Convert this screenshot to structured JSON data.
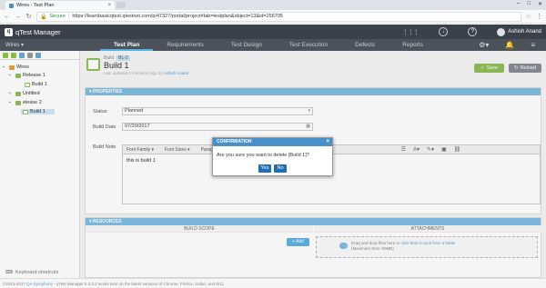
{
  "browser": {
    "tab_title": "Wires - Test Plan",
    "secure_label": "Secure",
    "url": "https://learnbasicqtest.qtestnet.com/p/47327/portal/project#tab=testplan&object=13&id=256705"
  },
  "app": {
    "logo_letter": "q",
    "app_name": "qTest Manager",
    "project": "Wires",
    "user_name": "Ashish Anand",
    "nav_tabs": [
      "Test Plan",
      "Requirements",
      "Test Design",
      "Test Execution",
      "Defects",
      "Reports"
    ]
  },
  "tree": {
    "root": "Wires",
    "release1": "Release 1",
    "build_under_release1": "Build 1",
    "untitled": "Untitled",
    "release2": "elease 2",
    "build_selected": "Build 1",
    "keyboard_shortcuts": "Keyboard shortcuts"
  },
  "build": {
    "type_label": "Build",
    "id_badge": "BL-2",
    "name": "Build 1",
    "last_updated_prefix": "Last updated 2 minute(s) ago by",
    "last_updated_by": "Ashish Anand",
    "save_label": "Save",
    "reload_label": "Reload"
  },
  "properties": {
    "header": "PROPERTIES",
    "status_label": "Status",
    "status_value": "Planned",
    "date_label": "Build Date",
    "date_value": "07/20/2017",
    "note_label": "Build Note",
    "font_family": "Font Family",
    "font_size": "Font Sizes",
    "paragraph": "Paragr",
    "note_text": "this is build 1"
  },
  "resources": {
    "header": "RESOURCES",
    "build_scope": "BUILD SCOPE",
    "attachments": "ATTACHMENTS",
    "add_label": "+ Add",
    "drop_text": "Drag and drop files here or",
    "drop_link": "click here to pick from a folder",
    "max_size": "(Maximum Size: 50MB)"
  },
  "modal": {
    "title": "CONFIRMATION",
    "message": "Are you sure you want to delete [Build 1]?",
    "yes": "Yes",
    "no": "No"
  },
  "footer": {
    "copyright": "©2013-2017",
    "company": "QA Symphony",
    "notice": "- qTest Manager 8.3.3.2 works best on the latest versions of Chrome, Firefox, Safari, and IE11"
  }
}
